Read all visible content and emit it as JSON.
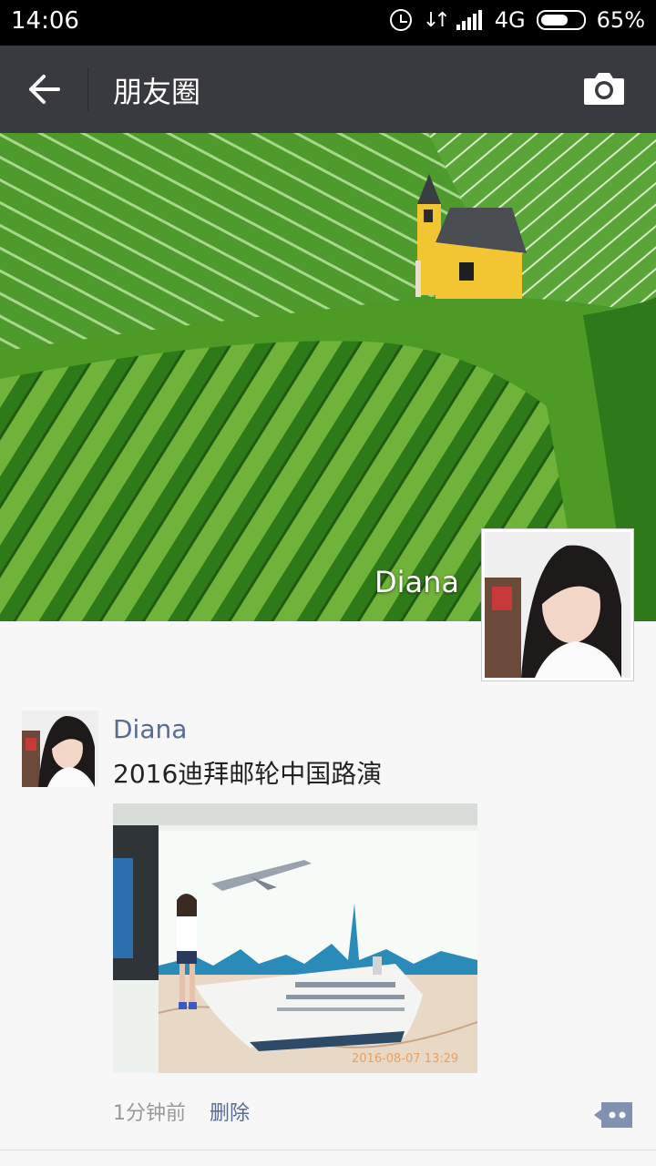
{
  "status_bar": {
    "time": "14:06",
    "network": "4G",
    "battery": "65%",
    "battery_level": 0.65
  },
  "header": {
    "title": "朋友圈",
    "back_icon": "arrow-left-icon",
    "camera_icon": "camera-icon"
  },
  "cover": {
    "user_name": "Diana"
  },
  "post": {
    "author": "Diana",
    "text": "2016迪拜邮轮中国路演",
    "image_timestamp": "2016-08-07 13:29",
    "time_ago": "1分钟前",
    "delete_label": "删除",
    "comment_icon": "comment-more-icon"
  },
  "colors": {
    "header_bg": "#393a3f",
    "link": "#576b95",
    "page_bg": "#f7f7f7"
  }
}
